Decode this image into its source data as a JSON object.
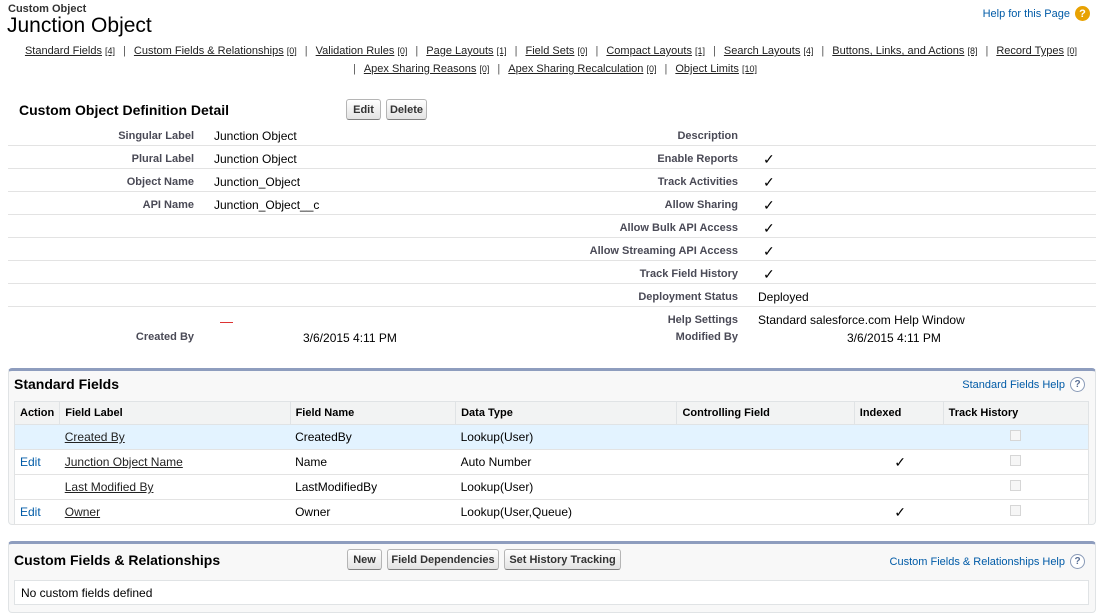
{
  "header": {
    "object_type": "Custom Object",
    "title": "Junction Object",
    "help_link": "Help for this Page"
  },
  "nav": {
    "row1": [
      {
        "label": "Standard Fields",
        "count": "[4]"
      },
      {
        "label": "Custom Fields & Relationships",
        "count": "[0]"
      },
      {
        "label": "Validation Rules",
        "count": "[0]"
      },
      {
        "label": "Page Layouts",
        "count": "[1]"
      },
      {
        "label": "Field Sets",
        "count": "[0]"
      },
      {
        "label": "Compact Layouts",
        "count": "[1]"
      },
      {
        "label": "Search Layouts",
        "count": "[4]"
      },
      {
        "label": "Buttons, Links, and Actions",
        "count": "[8]"
      },
      {
        "label": "Record Types",
        "count": "[0]"
      }
    ],
    "row2": [
      {
        "label": "Apex Sharing Reasons",
        "count": "[0]"
      },
      {
        "label": "Apex Sharing Recalculation",
        "count": "[0]"
      },
      {
        "label": "Object Limits",
        "count": "[10]"
      }
    ]
  },
  "detail": {
    "title": "Custom Object Definition Detail",
    "edit_label": "Edit",
    "delete_label": "Delete",
    "left_fields": [
      {
        "label": "Singular Label",
        "value": "Junction Object"
      },
      {
        "label": "Plural Label",
        "value": "Junction Object"
      },
      {
        "label": "Object Name",
        "value": "Junction_Object"
      },
      {
        "label": "API Name",
        "value": "Junction_Object__c"
      }
    ],
    "right_fields": [
      {
        "label": "Description",
        "value": ""
      },
      {
        "label": "Enable Reports",
        "check": true
      },
      {
        "label": "Track Activities",
        "check": true
      },
      {
        "label": "Allow Sharing",
        "check": true
      },
      {
        "label": "Allow Bulk API Access",
        "check": true
      },
      {
        "label": "Allow Streaming API Access",
        "check": true
      },
      {
        "label": "Track Field History",
        "check": true
      },
      {
        "label": "Deployment Status",
        "value": "Deployed"
      },
      {
        "label": "Help Settings",
        "value": "Standard salesforce.com Help Window"
      }
    ],
    "created_by_label": "Created By",
    "created_date": "3/6/2015 4:11 PM",
    "modified_by_label": "Modified By",
    "modified_date": "3/6/2015 4:11 PM",
    "check_glyph": "✓"
  },
  "standard_fields": {
    "title": "Standard Fields",
    "help_link": "Standard Fields Help",
    "columns": [
      "Action",
      "Field Label",
      "Field Name",
      "Data Type",
      "Controlling Field",
      "Indexed",
      "Track History"
    ],
    "rows": [
      {
        "action": "",
        "label": "Created By",
        "name": "CreatedBy",
        "type": "Lookup(User)",
        "controlling": "",
        "indexed": false
      },
      {
        "action": "Edit",
        "label": "Junction Object Name",
        "name": "Name",
        "type": "Auto Number",
        "controlling": "",
        "indexed": true
      },
      {
        "action": "",
        "label": "Last Modified By",
        "name": "LastModifiedBy",
        "type": "Lookup(User)",
        "controlling": "",
        "indexed": false
      },
      {
        "action": "Edit",
        "label": "Owner",
        "name": "Owner",
        "type": "Lookup(User,Queue)",
        "controlling": "",
        "indexed": true
      }
    ]
  },
  "custom_fields": {
    "title": "Custom Fields & Relationships",
    "new_label": "New",
    "dependencies_label": "Field Dependencies",
    "history_label": "Set History Tracking",
    "help_link": "Custom Fields & Relationships Help",
    "empty_text": "No custom fields defined"
  },
  "colors": {
    "link": "#015ba7",
    "help_icon": "#e8a202",
    "section_border": "#8e9dbe",
    "highlight_row": "#e3f3ff"
  }
}
